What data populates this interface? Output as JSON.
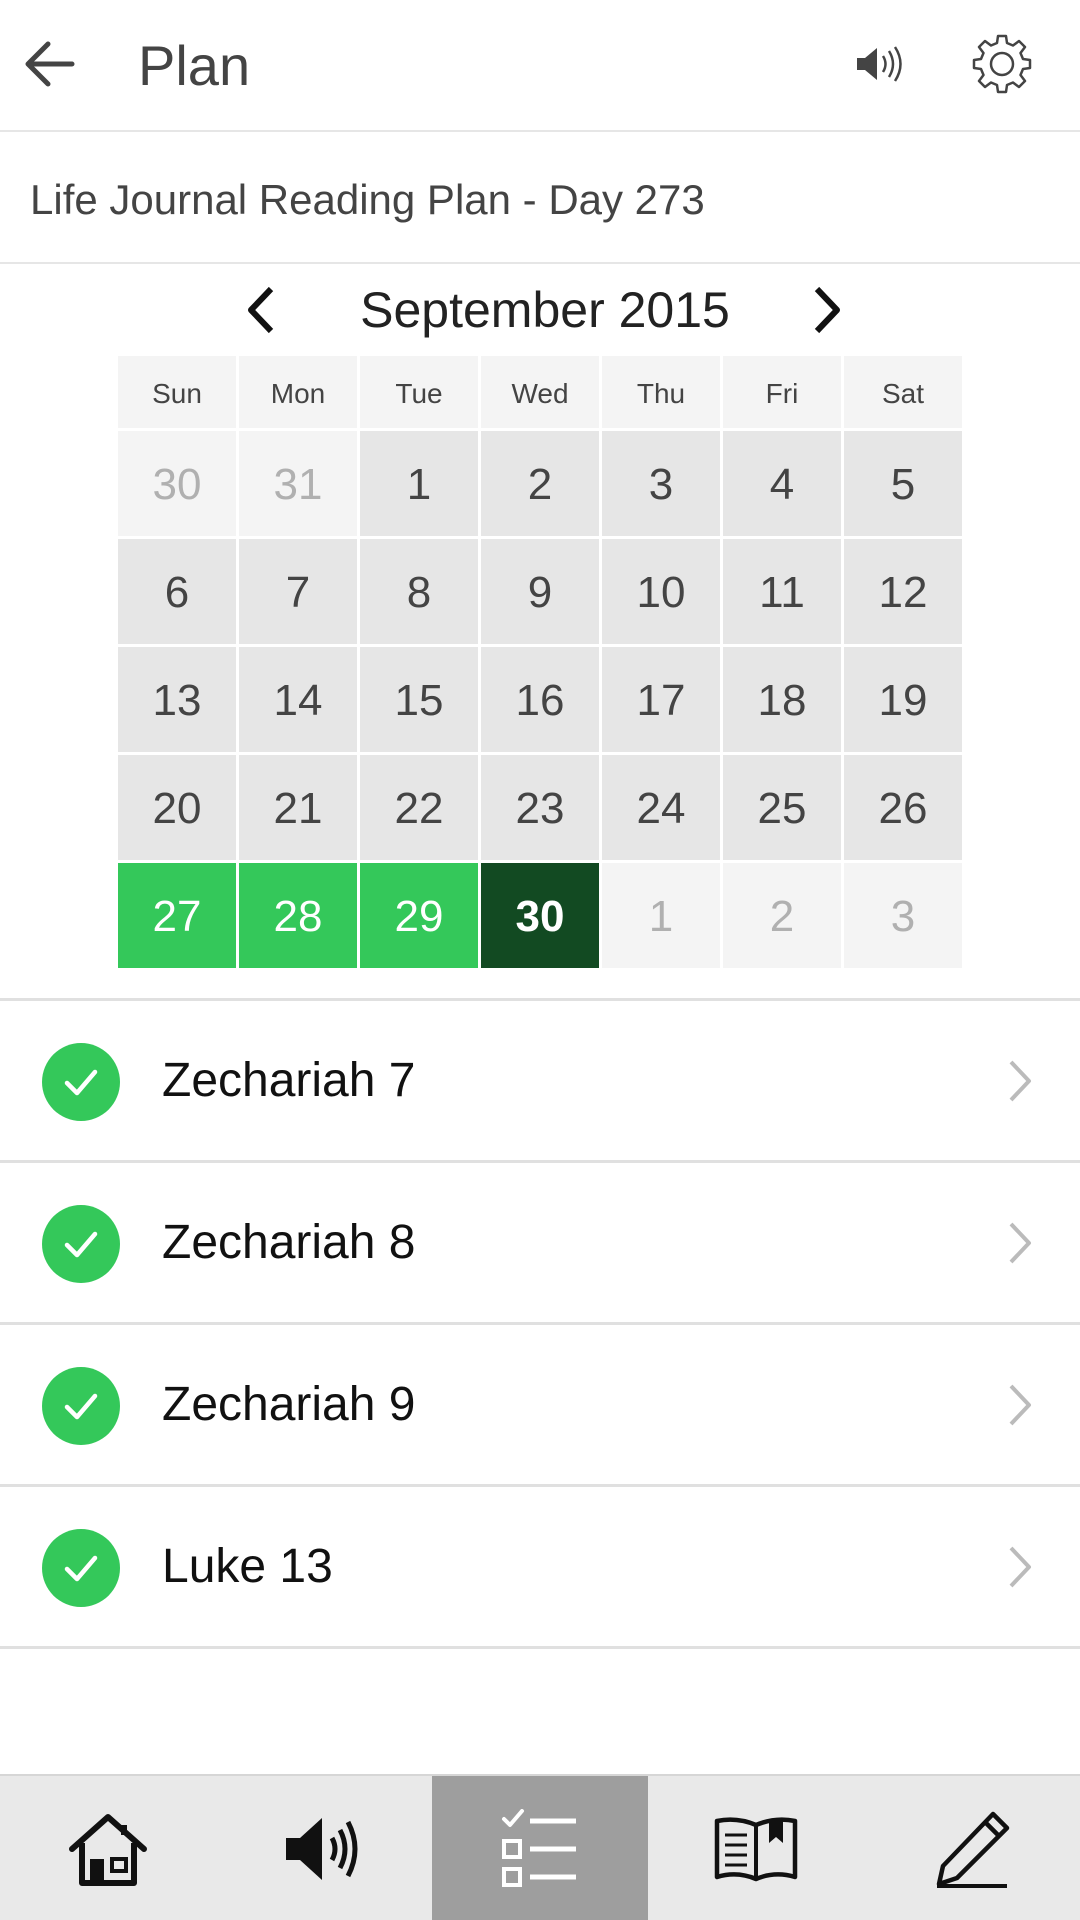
{
  "appbar": {
    "title": "Plan"
  },
  "plan": {
    "name": "Life Journal Reading Plan - Day 273"
  },
  "calendar": {
    "month_label": "September 2015",
    "weekdays": [
      "Sun",
      "Mon",
      "Tue",
      "Wed",
      "Thu",
      "Fri",
      "Sat"
    ],
    "days": [
      {
        "label": "30",
        "state": "muted"
      },
      {
        "label": "31",
        "state": "muted"
      },
      {
        "label": "1",
        "state": "normal"
      },
      {
        "label": "2",
        "state": "normal"
      },
      {
        "label": "3",
        "state": "normal"
      },
      {
        "label": "4",
        "state": "normal"
      },
      {
        "label": "5",
        "state": "normal"
      },
      {
        "label": "6",
        "state": "normal"
      },
      {
        "label": "7",
        "state": "normal"
      },
      {
        "label": "8",
        "state": "normal"
      },
      {
        "label": "9",
        "state": "normal"
      },
      {
        "label": "10",
        "state": "normal"
      },
      {
        "label": "11",
        "state": "normal"
      },
      {
        "label": "12",
        "state": "normal"
      },
      {
        "label": "13",
        "state": "normal"
      },
      {
        "label": "14",
        "state": "normal"
      },
      {
        "label": "15",
        "state": "normal"
      },
      {
        "label": "16",
        "state": "normal"
      },
      {
        "label": "17",
        "state": "normal"
      },
      {
        "label": "18",
        "state": "normal"
      },
      {
        "label": "19",
        "state": "normal"
      },
      {
        "label": "20",
        "state": "normal"
      },
      {
        "label": "21",
        "state": "normal"
      },
      {
        "label": "22",
        "state": "normal"
      },
      {
        "label": "23",
        "state": "normal"
      },
      {
        "label": "24",
        "state": "normal"
      },
      {
        "label": "25",
        "state": "normal"
      },
      {
        "label": "26",
        "state": "normal"
      },
      {
        "label": "27",
        "state": "done"
      },
      {
        "label": "28",
        "state": "done"
      },
      {
        "label": "29",
        "state": "done"
      },
      {
        "label": "30",
        "state": "today"
      },
      {
        "label": "1",
        "state": "muted"
      },
      {
        "label": "2",
        "state": "muted"
      },
      {
        "label": "3",
        "state": "muted"
      }
    ]
  },
  "readings": [
    {
      "label": "Zechariah 7",
      "completed": true
    },
    {
      "label": "Zechariah 8",
      "completed": true
    },
    {
      "label": "Zechariah 9",
      "completed": true
    },
    {
      "label": "Luke 13",
      "completed": true
    }
  ],
  "bottom_nav": {
    "tabs": [
      {
        "icon": "home-icon",
        "active": false
      },
      {
        "icon": "speaker-icon",
        "active": false
      },
      {
        "icon": "checklist-icon",
        "active": true
      },
      {
        "icon": "book-icon",
        "active": false
      },
      {
        "icon": "pencil-icon",
        "active": false
      }
    ]
  },
  "colors": {
    "completed_green": "#34c85a",
    "today_dark_green": "#124a22",
    "day_cell_gray": "#e6e6e6",
    "muted_cell": "#f4f4f4",
    "active_tab": "#9e9e9e"
  }
}
